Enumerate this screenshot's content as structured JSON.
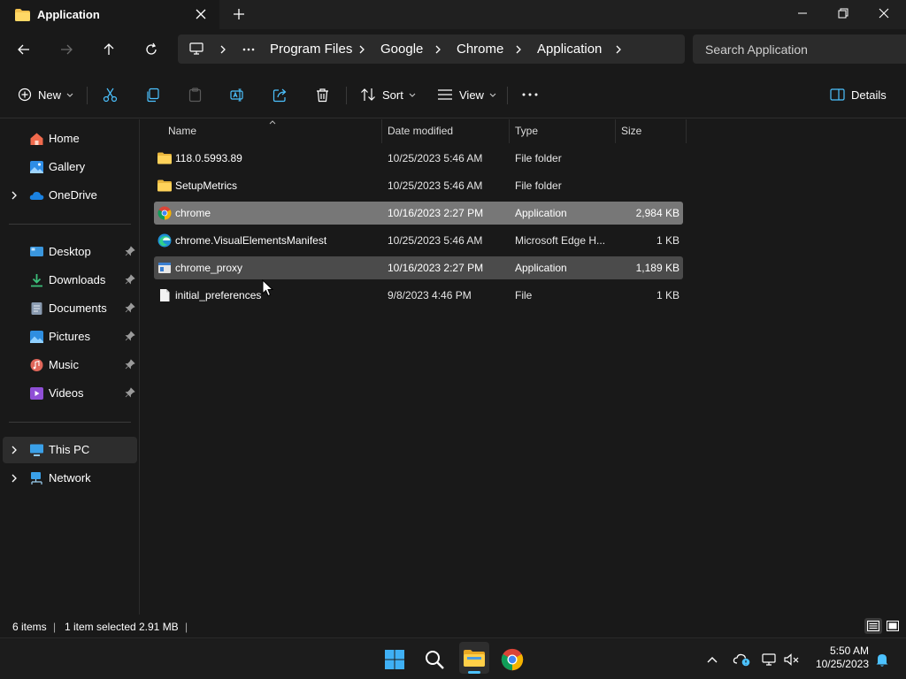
{
  "window": {
    "tab_title": "Application"
  },
  "address": {
    "crumbs": [
      "Program Files",
      "Google",
      "Chrome",
      "Application"
    ],
    "search_placeholder": "Search Application"
  },
  "commands": {
    "new_label": "New",
    "sort_label": "Sort",
    "view_label": "View",
    "details_label": "Details"
  },
  "sidebar": {
    "quick": [
      {
        "label": "Home",
        "icon": "home-icon"
      },
      {
        "label": "Gallery",
        "icon": "gallery-icon"
      },
      {
        "label": "OneDrive",
        "icon": "onedrive-icon"
      }
    ],
    "pinned": [
      {
        "label": "Desktop",
        "icon": "desktop-icon"
      },
      {
        "label": "Downloads",
        "icon": "downloads-icon"
      },
      {
        "label": "Documents",
        "icon": "documents-icon"
      },
      {
        "label": "Pictures",
        "icon": "pictures-icon"
      },
      {
        "label": "Music",
        "icon": "music-icon"
      },
      {
        "label": "Videos",
        "icon": "videos-icon"
      }
    ],
    "devices": [
      {
        "label": "This PC",
        "icon": "this-pc-icon"
      },
      {
        "label": "Network",
        "icon": "network-icon"
      }
    ]
  },
  "columns": {
    "name": "Name",
    "date": "Date modified",
    "type": "Type",
    "size": "Size"
  },
  "files": [
    {
      "name": "118.0.5993.89",
      "date": "10/25/2023 5:46 AM",
      "type": "File folder",
      "size": "",
      "icon": "folder-icon",
      "state": ""
    },
    {
      "name": "SetupMetrics",
      "date": "10/25/2023 5:46 AM",
      "type": "File folder",
      "size": "",
      "icon": "folder-icon",
      "state": ""
    },
    {
      "name": "chrome",
      "date": "10/16/2023 2:27 PM",
      "type": "Application",
      "size": "2,984 KB",
      "icon": "chrome-icon",
      "state": "selected"
    },
    {
      "name": "chrome.VisualElementsManifest",
      "date": "10/25/2023 5:46 AM",
      "type": "Microsoft Edge H...",
      "size": "1 KB",
      "icon": "edge-icon",
      "state": ""
    },
    {
      "name": "chrome_proxy",
      "date": "10/16/2023 2:27 PM",
      "type": "Application",
      "size": "1,189 KB",
      "icon": "app-icon",
      "state": "hover"
    },
    {
      "name": "initial_preferences",
      "date": "9/8/2023 4:46 PM",
      "type": "File",
      "size": "1 KB",
      "icon": "file-icon",
      "state": ""
    }
  ],
  "status": {
    "item_count": "6 items",
    "selection": "1 item selected",
    "selection_size": "2.91 MB"
  },
  "clock": {
    "time": "5:50 AM",
    "date": "10/25/2023"
  },
  "colors": {
    "background": "#191919",
    "selected_row": "#777777",
    "hover_row": "#4b4b4b",
    "folder": "#f2c14e",
    "accent": "#4cc2ff"
  }
}
